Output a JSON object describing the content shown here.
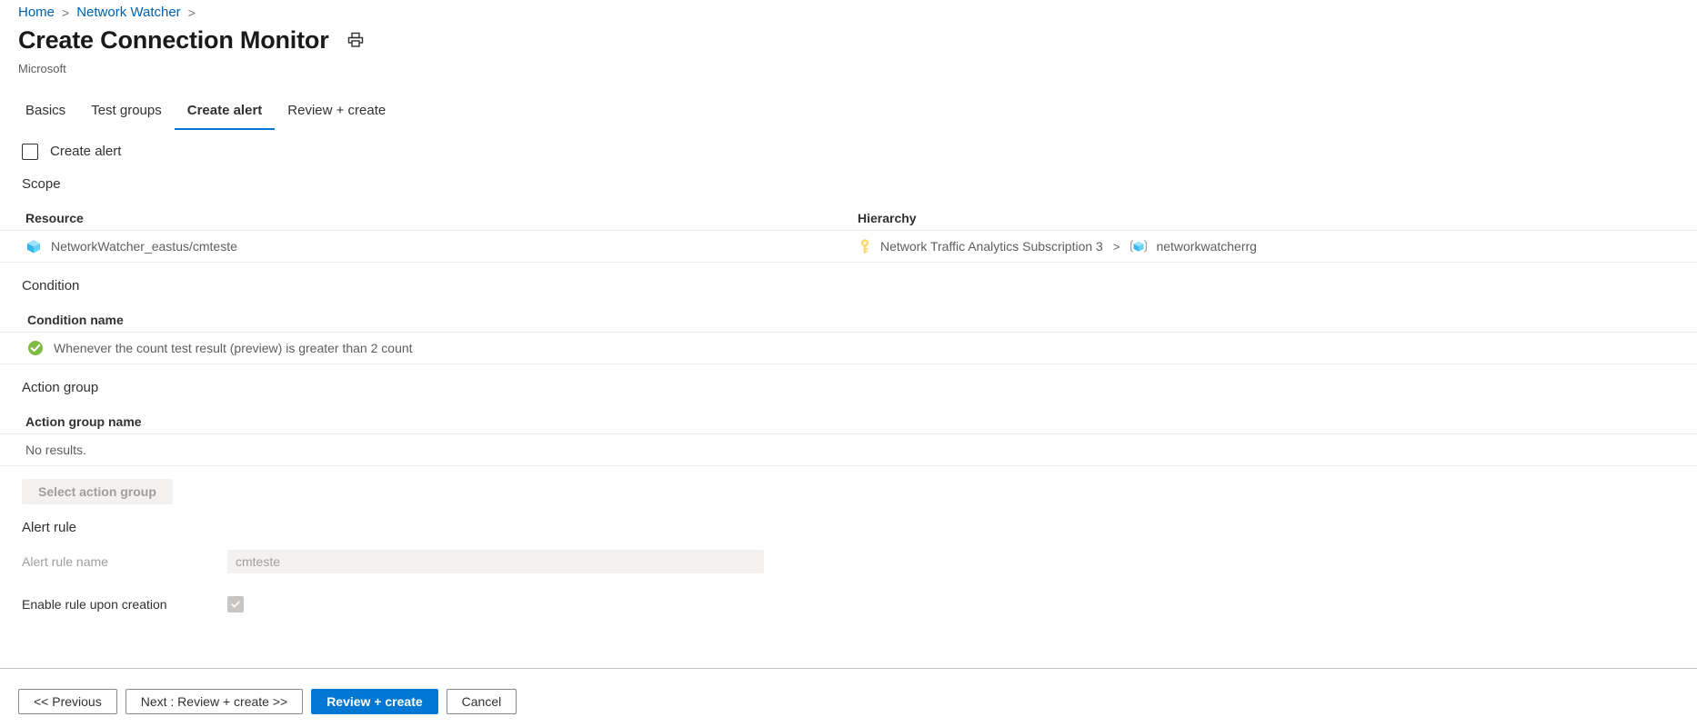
{
  "breadcrumb": {
    "items": [
      {
        "label": "Home",
        "sep": ">"
      },
      {
        "label": "Network Watcher",
        "sep": ">"
      }
    ]
  },
  "header": {
    "title": "Create Connection Monitor",
    "subtitle": "Microsoft",
    "print_icon": "print-icon"
  },
  "tabs": [
    {
      "label": "Basics",
      "active": false
    },
    {
      "label": "Test groups",
      "active": false
    },
    {
      "label": "Create alert",
      "active": true
    },
    {
      "label": "Review + create",
      "active": false
    }
  ],
  "create_alert": {
    "checkbox_label": "Create alert",
    "checked": false
  },
  "scope": {
    "section_label": "Scope",
    "columns": {
      "resource": "Resource",
      "hierarchy": "Hierarchy"
    },
    "row": {
      "resource_icon": "cube-icon",
      "resource": "NetworkWatcher_eastus/cmteste",
      "subscription_icon": "key-icon",
      "subscription": "Network Traffic Analytics Subscription 3",
      "separator": ">",
      "resource_group_icon": "resource-group-icon",
      "resource_group": "networkwatcherrg"
    }
  },
  "condition": {
    "section_label": "Condition",
    "column_header": "Condition name",
    "status_icon": "green-check-icon",
    "text": "Whenever the count test result (preview) is greater than 2 count"
  },
  "action_group": {
    "section_label": "Action group",
    "column_header": "Action group name",
    "empty_text": "No results.",
    "select_button": "Select action group"
  },
  "alert_rule": {
    "section_label": "Alert rule",
    "name_label": "Alert rule name",
    "name_value": "cmteste",
    "enable_label": "Enable rule upon creation",
    "enable_checked": true
  },
  "footer": {
    "previous": "<< Previous",
    "next": "Next : Review + create >>",
    "review_create": "Review + create",
    "cancel": "Cancel"
  },
  "colors": {
    "accent": "#0078d4",
    "link": "#0062ad",
    "success": "#7fba42",
    "cube": "#50c2f0",
    "key": "#ffc83d"
  }
}
